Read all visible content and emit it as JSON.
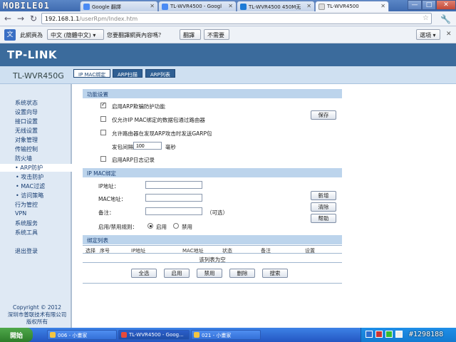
{
  "browser": {
    "watermark_logo": "MOBILE01",
    "tabs": [
      {
        "label": "Google 翻譯",
        "active": false
      },
      {
        "label": "TL-WVR4500 - Googl",
        "active": false
      },
      {
        "label": "TL-WVR4500 450M无",
        "active": false
      },
      {
        "label": "TL-WVR4500",
        "active": true
      }
    ],
    "url_host": "192.168.1.1",
    "url_path": "/userRpm/Index.htm",
    "window_controls": {
      "minimize": "—",
      "maximize": "□",
      "close": "✕"
    }
  },
  "translate_bar": {
    "icon": "文",
    "prefix": "此網頁為",
    "language": "中文 (簡體中文)",
    "question": "您要翻譯網頁內容嗎？",
    "translate_button": "翻譯",
    "no_button": "不需要",
    "options_button": "選項",
    "close": "✕"
  },
  "router": {
    "logo": "TP-LINK",
    "model": "TL-WVR450G",
    "tabs": [
      "IP MAC绑定",
      "ARP扫描",
      "ARP列表"
    ],
    "sidebar": [
      {
        "label": "系统状态"
      },
      {
        "label": "设置向导"
      },
      {
        "label": "接口设置"
      },
      {
        "label": "无线设置"
      },
      {
        "label": "对象管理"
      },
      {
        "label": "传输控制"
      },
      {
        "label": "防火墙"
      },
      {
        "label": "• ARP防护",
        "selected": true
      },
      {
        "label": "• 攻击防护"
      },
      {
        "label": "• MAC过滤"
      },
      {
        "label": "• 访问策略"
      },
      {
        "label": "行为管控"
      },
      {
        "label": "VPN"
      },
      {
        "label": "系统服务"
      },
      {
        "label": "系统工具"
      },
      {
        "label": "退出登录"
      }
    ],
    "copyright_line1": "Copyright © 2012",
    "copyright_line2": "深圳市普联技术有限公司",
    "copyright_line3": "版权所有"
  },
  "function_settings": {
    "header": "功能设置",
    "options": [
      {
        "label": "启用ARP欺骗防护功能",
        "checked": true
      },
      {
        "label": "仅允许IP MAC绑定的数据包通过路由器",
        "checked": false
      },
      {
        "label": "允许路由器在发现ARP攻击时发送GARP包",
        "checked": false
      }
    ],
    "interval_label": "发包间隔：",
    "interval_value": "100",
    "interval_unit": "毫秒",
    "log_label": "启用ARP日志记录",
    "log_checked": false,
    "save_button": "保存"
  },
  "binding": {
    "header": "IP MAC绑定",
    "ip_label": "IP地址：",
    "mac_label": "MAC地址：",
    "note_label": "备注：",
    "note_hint": "（可选）",
    "enable_label": "启用/禁用规则：",
    "enable_option": "启用",
    "disable_option": "禁用",
    "enabled": true,
    "add_button": "新增",
    "clear_button": "清除",
    "help_button": "帮助"
  },
  "binding_list": {
    "header": "绑定列表",
    "columns": [
      "选择",
      "序号",
      "IP地址",
      "MAC地址",
      "状态",
      "备注",
      "设置"
    ],
    "empty_text": "该列表为空",
    "buttons": [
      "全选",
      "启用",
      "禁用",
      "删除",
      "搜索"
    ]
  },
  "taskbar": {
    "start": "開始",
    "tasks": [
      {
        "label": "006 - 小畫家"
      },
      {
        "label": "TL-WVR4500 - Goog..."
      },
      {
        "label": "021 - 小畫家"
      }
    ],
    "watermark": "#1298188"
  }
}
